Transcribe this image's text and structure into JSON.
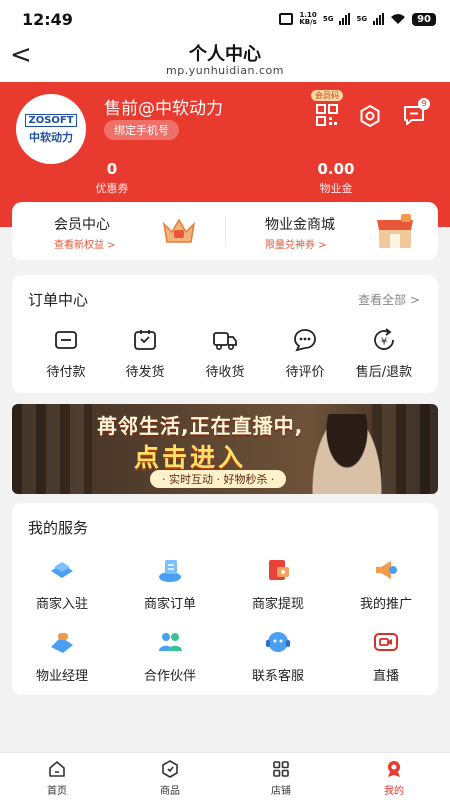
{
  "status_bar": {
    "time": "12:49",
    "net_speed_top": "1.10",
    "net_speed_bottom": "KB/s",
    "sig1": "5G",
    "sig2": "5G",
    "battery": "90"
  },
  "nav": {
    "title": "个人中心",
    "url": "mp.yunhuidian.com"
  },
  "profile": {
    "logo_top": "ZOSOFT",
    "logo_bottom": "中软动力",
    "username": "售前@中软动力",
    "bind_phone": "绑定手机号",
    "member_code_tag": "会员码",
    "message_badge": "9"
  },
  "stats": [
    {
      "value": "0",
      "label": "优惠券"
    },
    {
      "value": "0.00",
      "label": "物业金"
    }
  ],
  "member_card": {
    "left": {
      "title": "会员中心",
      "subtitle": "查看新权益 >"
    },
    "right": {
      "title": "物业金商城",
      "subtitle": "限量兑神券 >"
    }
  },
  "orders": {
    "title": "订单中心",
    "see_all": "查看全部 >",
    "items": [
      {
        "label": "待付款",
        "icon": "wallet-icon"
      },
      {
        "label": "待发货",
        "icon": "box-icon"
      },
      {
        "label": "待收货",
        "icon": "truck-icon"
      },
      {
        "label": "待评价",
        "icon": "comment-icon"
      },
      {
        "label": "售后/退款",
        "icon": "refund-icon"
      }
    ]
  },
  "banner": {
    "line1": "苒邻生活,正在直播中,",
    "line2": "点击进入",
    "line3": "· 实时互动 · 好物秒杀 ·"
  },
  "services": {
    "title": "我的服务",
    "items": [
      {
        "label": "商家入驻",
        "icon": "merchant-join-icon"
      },
      {
        "label": "商家订单",
        "icon": "merchant-order-icon"
      },
      {
        "label": "商家提现",
        "icon": "merchant-withdraw-icon"
      },
      {
        "label": "我的推广",
        "icon": "promotion-icon"
      },
      {
        "label": "物业经理",
        "icon": "property-manager-icon"
      },
      {
        "label": "合作伙伴",
        "icon": "partner-icon"
      },
      {
        "label": "联系客服",
        "icon": "customer-service-icon"
      },
      {
        "label": "直播",
        "icon": "live-icon"
      }
    ]
  },
  "tabbar": {
    "items": [
      {
        "label": "首页",
        "icon": "home-icon"
      },
      {
        "label": "商品",
        "icon": "goods-icon"
      },
      {
        "label": "店铺",
        "icon": "shop-icon"
      },
      {
        "label": "我的",
        "icon": "profile-icon"
      }
    ],
    "active_index": 3
  },
  "colors": {
    "brand_red": "#e83a2e",
    "accent_orange": "#e8573a",
    "background": "#f2f2f2"
  }
}
